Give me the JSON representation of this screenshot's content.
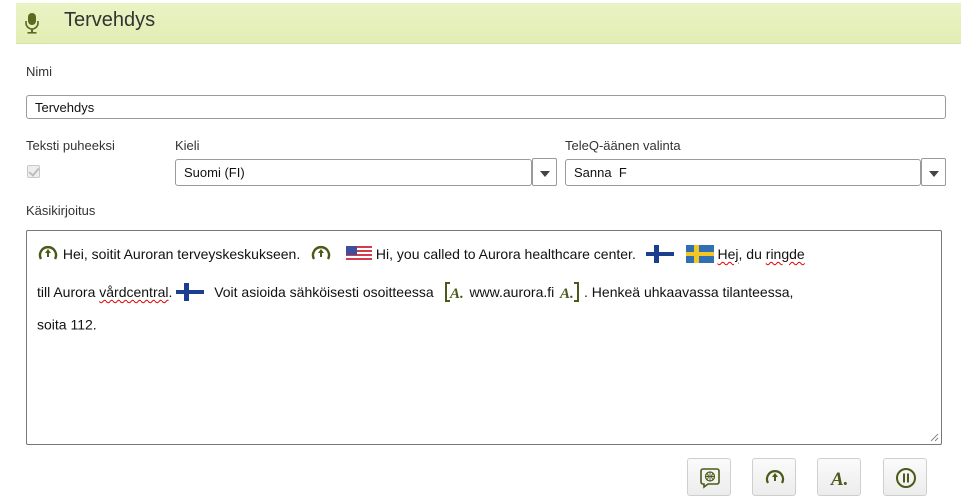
{
  "header": {
    "title": "Tervehdys",
    "icon": "microphone-icon"
  },
  "form": {
    "name_label": "Nimi",
    "name_value": "Tervehdys",
    "tts_label": "Teksti puheeksi",
    "tts_checked": true,
    "language_label": "Kieli",
    "language_value": "Suomi (FI)",
    "voice_label": "TeleQ-äänen valinta",
    "voice_value": "Sanna  F",
    "script_label": "Käsikirjoitus"
  },
  "script": {
    "seg1": "Hei, soitit Auroran terveyskeskukseen.",
    "seg2": "Hi, you called to Aurora healthcare center.",
    "seg3a": "Hej",
    "seg3b": ", du ",
    "seg3c": "ringde",
    "seg4a": "till Aurora ",
    "seg4b": "vårdcentral",
    "seg4c": ".",
    "seg5": "Voit asioida sähköisesti osoitteessa",
    "seg6": "www.aurora.fi",
    "seg7": ". Henkeä uhkaavassa tilanteessa,",
    "seg8": "soita 112."
  },
  "toolbar": {
    "buttons": [
      "language-icon",
      "pause-marker-icon",
      "spell-out-icon",
      "pause-icon"
    ]
  },
  "colors": {
    "header_bg": "#e4efb8",
    "accent_green": "#5a6b1f"
  }
}
